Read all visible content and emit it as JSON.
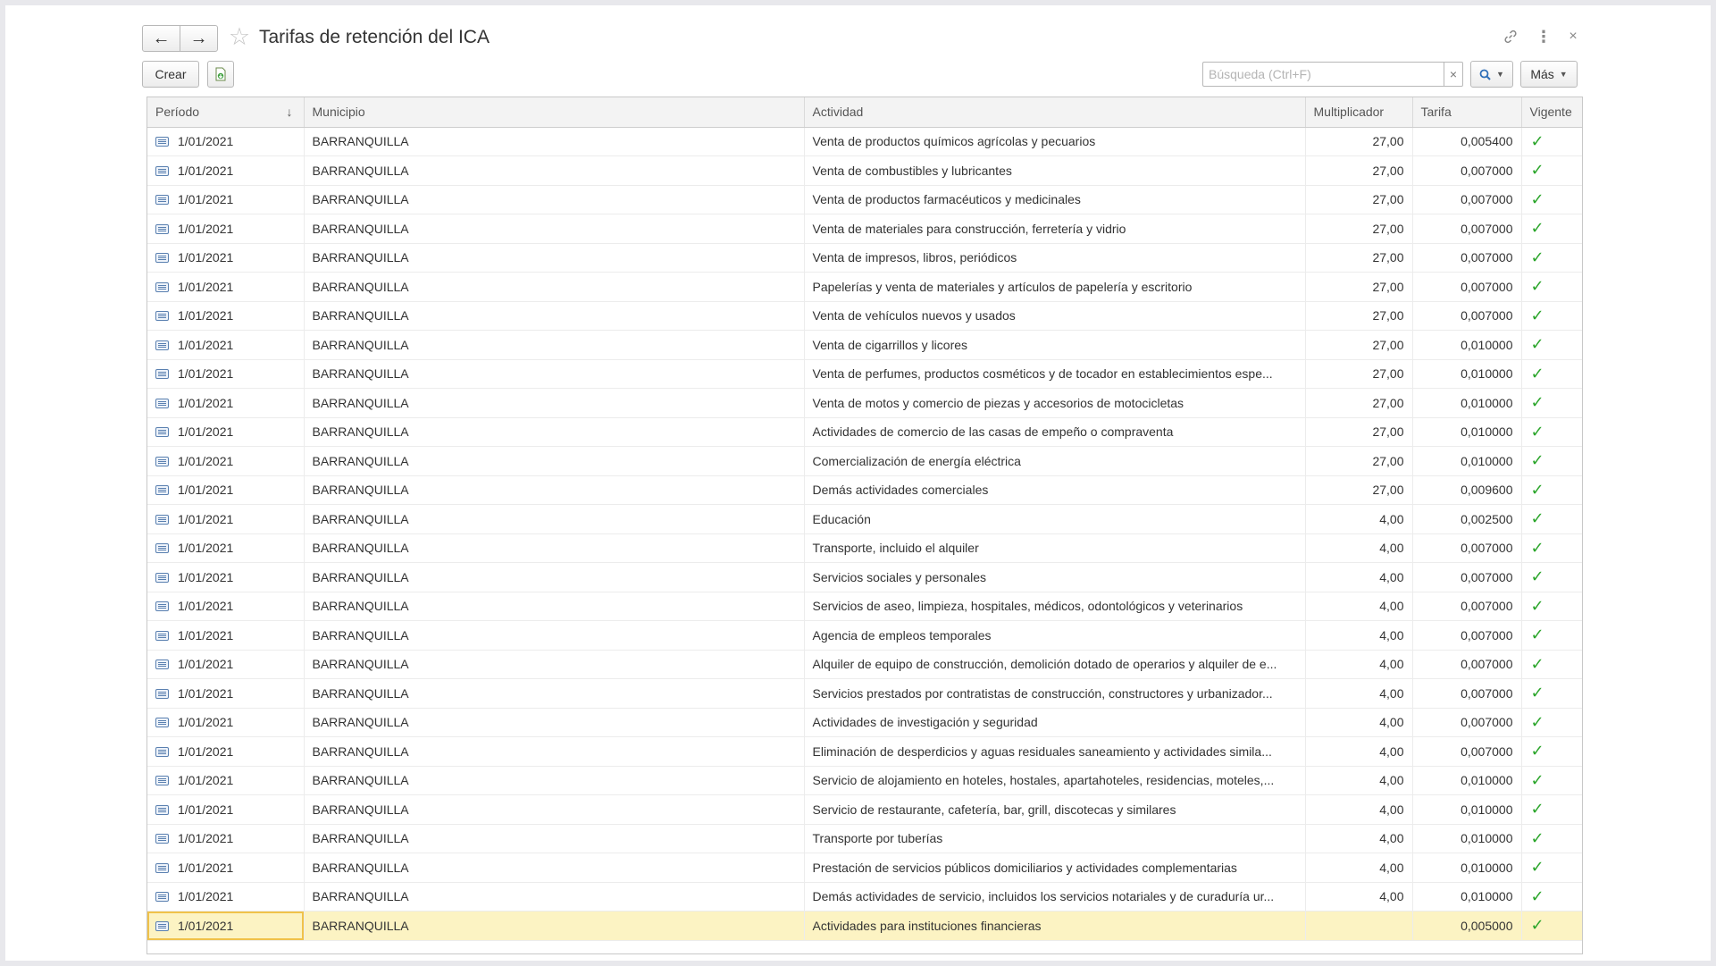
{
  "header": {
    "title": "Tarifas de retención del ICA",
    "back_icon": "←",
    "forward_icon": "→",
    "star_icon": "☆",
    "link_icon": "🔗",
    "more_icon": "⋮",
    "close_icon": "×"
  },
  "toolbar": {
    "create_label": "Crear",
    "search_placeholder": "Búsqueda (Ctrl+F)",
    "search_value": "",
    "clear_icon": "×",
    "search_icon": "🔍",
    "more_label": "Más",
    "dropdown_caret": "▼"
  },
  "table": {
    "columns": [
      "Período",
      "Municipio",
      "Actividad",
      "Multiplicador",
      "Tarifa",
      "Vigente"
    ],
    "sort_indicator": "↓",
    "check_glyph": "✓",
    "rows": [
      {
        "periodo": "1/01/2021",
        "municipio": "BARRANQUILLA",
        "actividad": "Venta de productos químicos agrícolas y pecuarios",
        "multiplicador": "27,00",
        "tarifa": "0,005400"
      },
      {
        "periodo": "1/01/2021",
        "municipio": "BARRANQUILLA",
        "actividad": "Venta de combustibles y lubricantes",
        "multiplicador": "27,00",
        "tarifa": "0,007000"
      },
      {
        "periodo": "1/01/2021",
        "municipio": "BARRANQUILLA",
        "actividad": "Venta de productos farmacéuticos y medicinales",
        "multiplicador": "27,00",
        "tarifa": "0,007000"
      },
      {
        "periodo": "1/01/2021",
        "municipio": "BARRANQUILLA",
        "actividad": "Venta de materiales para construcción, ferretería y vidrio",
        "multiplicador": "27,00",
        "tarifa": "0,007000"
      },
      {
        "periodo": "1/01/2021",
        "municipio": "BARRANQUILLA",
        "actividad": "Venta de impresos, libros, periódicos",
        "multiplicador": "27,00",
        "tarifa": "0,007000"
      },
      {
        "periodo": "1/01/2021",
        "municipio": "BARRANQUILLA",
        "actividad": "Papelerías y venta de materiales y artículos de papelería y escritorio",
        "multiplicador": "27,00",
        "tarifa": "0,007000"
      },
      {
        "periodo": "1/01/2021",
        "municipio": "BARRANQUILLA",
        "actividad": "Venta de vehículos nuevos y usados",
        "multiplicador": "27,00",
        "tarifa": "0,007000"
      },
      {
        "periodo": "1/01/2021",
        "municipio": "BARRANQUILLA",
        "actividad": "Venta de cigarrillos y licores",
        "multiplicador": "27,00",
        "tarifa": "0,010000"
      },
      {
        "periodo": "1/01/2021",
        "municipio": "BARRANQUILLA",
        "actividad": "Venta de perfumes, productos cosméticos y de tocador en establecimientos espe...",
        "multiplicador": "27,00",
        "tarifa": "0,010000"
      },
      {
        "periodo": "1/01/2021",
        "municipio": "BARRANQUILLA",
        "actividad": "Venta de motos y comercio de piezas y accesorios de motocicletas",
        "multiplicador": "27,00",
        "tarifa": "0,010000"
      },
      {
        "periodo": "1/01/2021",
        "municipio": "BARRANQUILLA",
        "actividad": "Actividades de comercio de las casas de empeño o compraventa",
        "multiplicador": "27,00",
        "tarifa": "0,010000"
      },
      {
        "periodo": "1/01/2021",
        "municipio": "BARRANQUILLA",
        "actividad": "Comercialización de energía eléctrica",
        "multiplicador": "27,00",
        "tarifa": "0,010000"
      },
      {
        "periodo": "1/01/2021",
        "municipio": "BARRANQUILLA",
        "actividad": "Demás actividades comerciales",
        "multiplicador": "27,00",
        "tarifa": "0,009600"
      },
      {
        "periodo": "1/01/2021",
        "municipio": "BARRANQUILLA",
        "actividad": "Educación",
        "multiplicador": "4,00",
        "tarifa": "0,002500"
      },
      {
        "periodo": "1/01/2021",
        "municipio": "BARRANQUILLA",
        "actividad": "Transporte, incluido el alquiler",
        "multiplicador": "4,00",
        "tarifa": "0,007000"
      },
      {
        "periodo": "1/01/2021",
        "municipio": "BARRANQUILLA",
        "actividad": "Servicios sociales y personales",
        "multiplicador": "4,00",
        "tarifa": "0,007000"
      },
      {
        "periodo": "1/01/2021",
        "municipio": "BARRANQUILLA",
        "actividad": "Servicios de aseo, limpieza, hospitales, médicos, odontológicos y veterinarios",
        "multiplicador": "4,00",
        "tarifa": "0,007000"
      },
      {
        "periodo": "1/01/2021",
        "municipio": "BARRANQUILLA",
        "actividad": "Agencia de empleos temporales",
        "multiplicador": "4,00",
        "tarifa": "0,007000"
      },
      {
        "periodo": "1/01/2021",
        "municipio": "BARRANQUILLA",
        "actividad": "Alquiler de equipo de construcción, demolición dotado de operarios y alquiler de e...",
        "multiplicador": "4,00",
        "tarifa": "0,007000"
      },
      {
        "periodo": "1/01/2021",
        "municipio": "BARRANQUILLA",
        "actividad": "Servicios prestados por contratistas de construcción, constructores y urbanizador...",
        "multiplicador": "4,00",
        "tarifa": "0,007000"
      },
      {
        "periodo": "1/01/2021",
        "municipio": "BARRANQUILLA",
        "actividad": "Actividades de investigación y seguridad",
        "multiplicador": "4,00",
        "tarifa": "0,007000"
      },
      {
        "periodo": "1/01/2021",
        "municipio": "BARRANQUILLA",
        "actividad": "Eliminación de desperdicios y aguas residuales saneamiento y actividades simila...",
        "multiplicador": "4,00",
        "tarifa": "0,007000"
      },
      {
        "periodo": "1/01/2021",
        "municipio": "BARRANQUILLA",
        "actividad": "Servicio de alojamiento en hoteles, hostales, apartahoteles, residencias, moteles,...",
        "multiplicador": "4,00",
        "tarifa": "0,010000"
      },
      {
        "periodo": "1/01/2021",
        "municipio": "BARRANQUILLA",
        "actividad": "Servicio de restaurante, cafetería, bar, grill, discotecas y similares",
        "multiplicador": "4,00",
        "tarifa": "0,010000"
      },
      {
        "periodo": "1/01/2021",
        "municipio": "BARRANQUILLA",
        "actividad": "Transporte por tuberías",
        "multiplicador": "4,00",
        "tarifa": "0,010000"
      },
      {
        "periodo": "1/01/2021",
        "municipio": "BARRANQUILLA",
        "actividad": "Prestación de servicios públicos domiciliarios y actividades complementarias",
        "multiplicador": "4,00",
        "tarifa": "0,010000"
      },
      {
        "periodo": "1/01/2021",
        "municipio": "BARRANQUILLA",
        "actividad": "Demás actividades de servicio, incluidos los servicios notariales y de curaduría ur...",
        "multiplicador": "4,00",
        "tarifa": "0,010000"
      },
      {
        "periodo": "1/01/2021",
        "municipio": "BARRANQUILLA",
        "actividad": "Actividades para instituciones financieras",
        "multiplicador": "",
        "tarifa": "0,005000",
        "selected": true
      }
    ]
  },
  "colors": {
    "check_green": "#2aa52a",
    "selected_row": "#fcf3c3",
    "selected_cell_border": "#f0c24a",
    "row_icon_blue": "#5a80b0"
  },
  "icons": {
    "row_icon": "record-icon",
    "save_to_file": "save-document-icon"
  }
}
